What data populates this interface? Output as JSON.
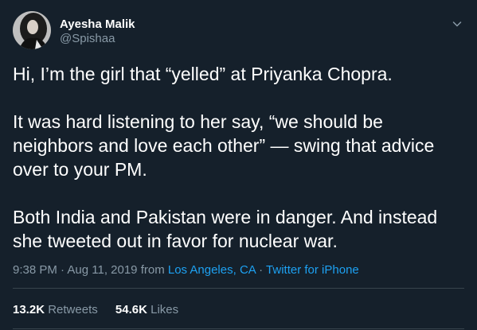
{
  "author": {
    "name": "Ayesha Malik",
    "handle": "@Spishaa"
  },
  "tweet": {
    "paragraphs": [
      "Hi, I’m the girl that “yelled” at Priyanka Chopra.",
      "It was hard listening to her say, “we should be\nneighbors and love each other” — swing that advice\nover to your PM.",
      "Both India and Pakistan were in danger. And instead\nshe tweeted out in favor for nuclear war."
    ],
    "time": "9:38 PM",
    "separator": "·",
    "date": "Aug 11, 2019",
    "from_text": "from",
    "location": "Los Angeles, CA",
    "source": "Twitter for iPhone"
  },
  "stats": {
    "retweets_count": "13.2K",
    "retweets_label": "Retweets",
    "likes_count": "54.6K",
    "likes_label": "Likes"
  },
  "icons": {
    "caret": "chevron-down-icon"
  },
  "colors": {
    "background": "#15202b",
    "secondary_text": "#8899a6",
    "link": "#1da1f2",
    "divider": "#38444d"
  }
}
